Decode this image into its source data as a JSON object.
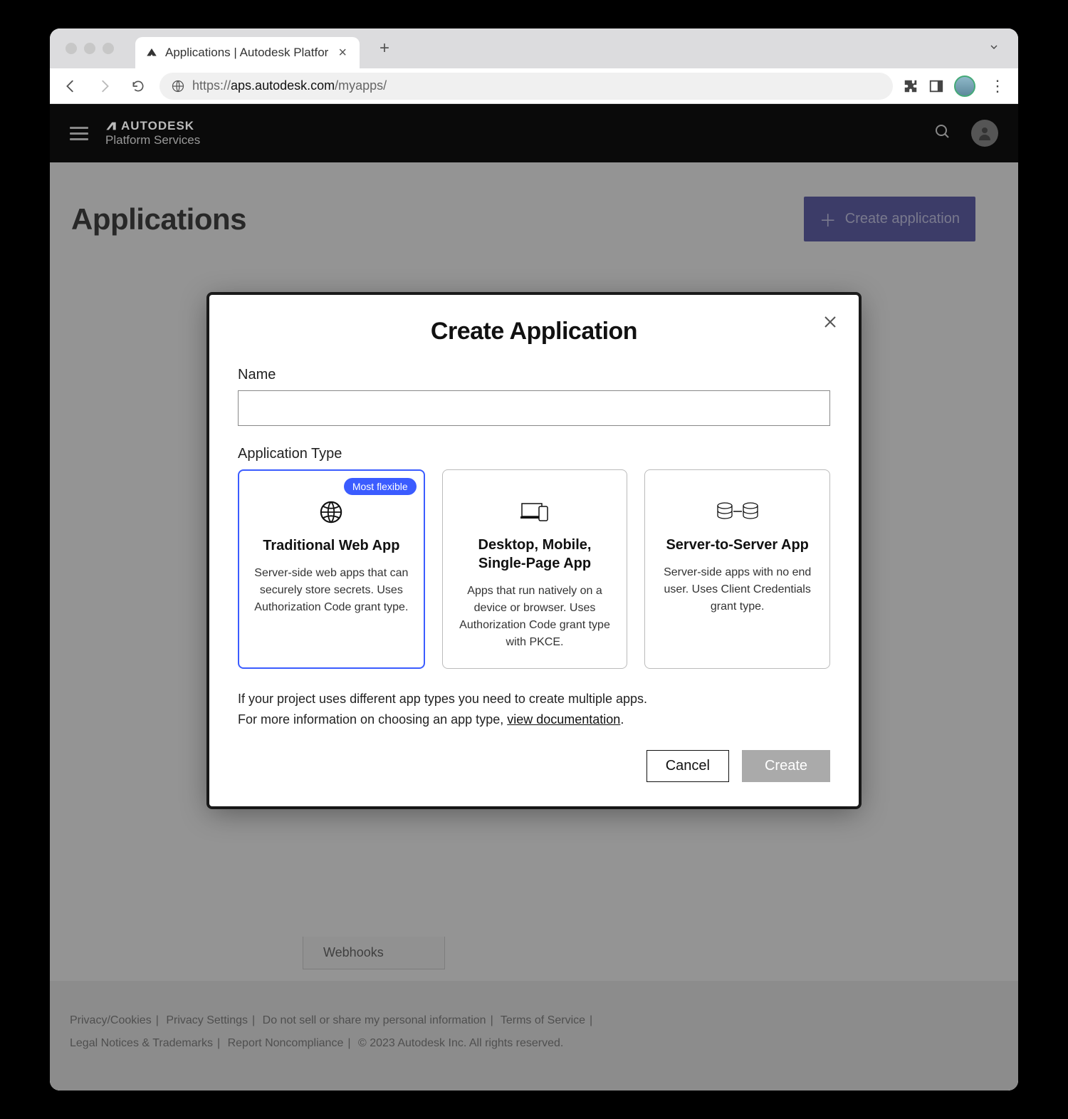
{
  "browser": {
    "tab_title": "Applications | Autodesk Platfor",
    "url_proto": "https://",
    "url_domain": "aps.autodesk.com",
    "url_path": "/myapps/"
  },
  "header": {
    "brand_top": "AUTODESK",
    "brand_bottom": "Platform Services"
  },
  "page": {
    "title": "Applications",
    "create_button": "Create application"
  },
  "bg_item": "Webhooks",
  "footer": {
    "links": [
      "Privacy/Cookies",
      "Privacy Settings",
      "Do not sell or share my personal information",
      "Terms of Service",
      "Legal Notices & Trademarks",
      "Report Noncompliance"
    ],
    "copyright": "© 2023 Autodesk Inc. All rights reserved."
  },
  "modal": {
    "title": "Create Application",
    "name_label": "Name",
    "name_value": "",
    "type_label": "Application Type",
    "badge": "Most flexible",
    "cards": [
      {
        "title": "Traditional Web App",
        "desc": "Server-side web apps that can securely store secrets. Uses Authorization Code grant type."
      },
      {
        "title": "Desktop, Mobile, Single-Page App",
        "desc": "Apps that run natively on a device or browser. Uses Authorization Code grant type with PKCE."
      },
      {
        "title": "Server-to-Server App",
        "desc": "Server-side apps with no end user. Uses Client Credentials grant type."
      }
    ],
    "hint1": "If your project uses different app types you need to create multiple apps.",
    "hint2_pre": "For more information on choosing an app type, ",
    "hint2_link": "view documentation",
    "hint2_post": ".",
    "cancel": "Cancel",
    "create": "Create"
  }
}
